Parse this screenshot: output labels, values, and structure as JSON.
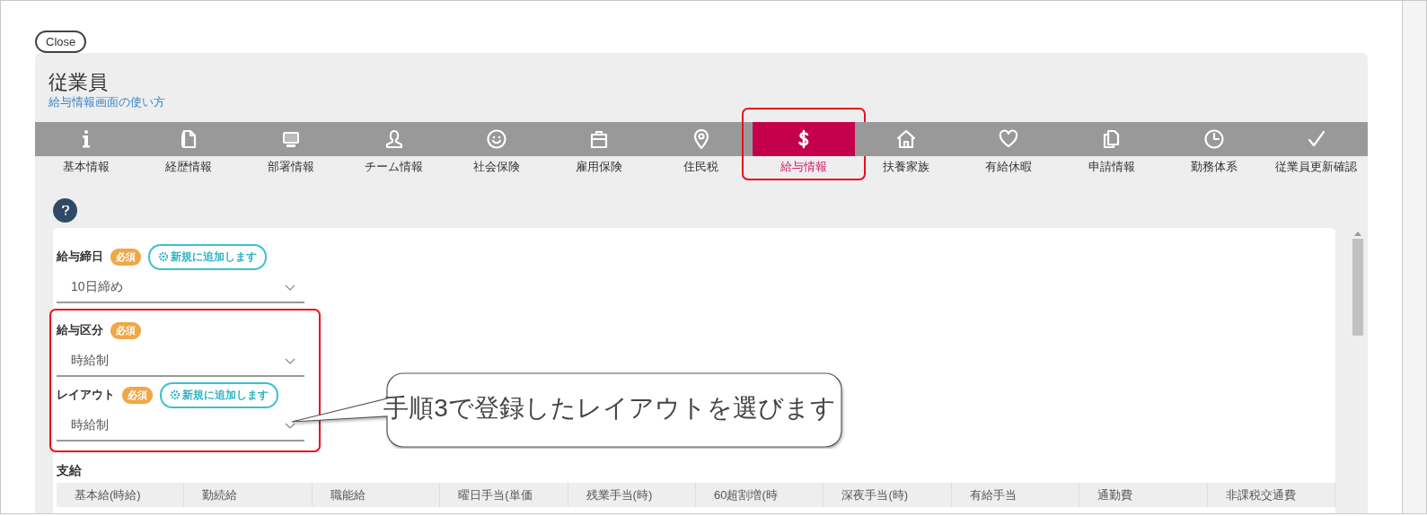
{
  "close_button": "Close",
  "header": {
    "title": "従業員",
    "help_link": "給与情報画面の使い方"
  },
  "tabs": [
    {
      "label": "基本情報",
      "kind": "info",
      "selected": false,
      "highlighted": false
    },
    {
      "label": "経歴情報",
      "kind": "document",
      "selected": false,
      "highlighted": false
    },
    {
      "label": "部署情報",
      "kind": "monitor",
      "selected": false,
      "highlighted": false
    },
    {
      "label": "チーム情報",
      "kind": "person",
      "selected": false,
      "highlighted": false
    },
    {
      "label": "社会保険",
      "kind": "smiley",
      "selected": false,
      "highlighted": false
    },
    {
      "label": "雇用保険",
      "kind": "briefcase",
      "selected": false,
      "highlighted": false
    },
    {
      "label": "住民税",
      "kind": "pin",
      "selected": false,
      "highlighted": false
    },
    {
      "label": "給与情報",
      "kind": "dollar",
      "selected": true,
      "highlighted": true
    },
    {
      "label": "扶養家族",
      "kind": "house",
      "selected": false,
      "highlighted": false
    },
    {
      "label": "有給休暇",
      "kind": "heart",
      "selected": false,
      "highlighted": false
    },
    {
      "label": "申請情報",
      "kind": "copy",
      "selected": false,
      "highlighted": false
    },
    {
      "label": "勤務体系",
      "kind": "clock",
      "selected": false,
      "highlighted": false
    },
    {
      "label": "従業員更新確認",
      "kind": "check",
      "selected": false,
      "highlighted": false
    }
  ],
  "form": {
    "fields": [
      {
        "label": "給与締日",
        "required_badge": "必須",
        "add_button": "新規に追加します",
        "value": "10日締め",
        "highlighted": false
      },
      {
        "label": "給与区分",
        "required_badge": "必須",
        "value": "時給制",
        "highlighted": true
      },
      {
        "label": "レイアウト",
        "required_badge": "必須",
        "add_button": "新規に追加します",
        "value": "時給制",
        "highlighted": true
      }
    ],
    "section_title": "支給",
    "table": {
      "columns": [
        "基本給(時給)",
        "勤続給",
        "職能給",
        "曜日手当(単価",
        "残業手当(時)",
        "60超割増(時",
        "深夜手当(時)",
        "有給手当",
        "通勤費",
        "非課税交通費"
      ]
    }
  },
  "annotation": {
    "callout": "手順3で登録したレイアウトを選びます"
  }
}
